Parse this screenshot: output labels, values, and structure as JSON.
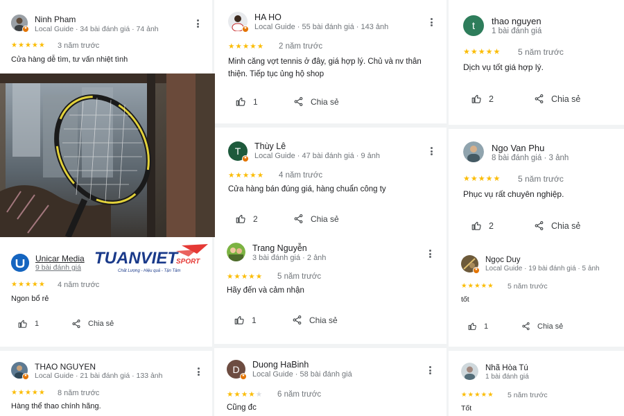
{
  "colors": {
    "star": "#fbbc04",
    "accent_red": "#e53935",
    "logo_blue": "#1a3a8a",
    "guide_badge": "#e37400"
  },
  "action_labels": {
    "share": "Chia sẻ"
  },
  "brand": {
    "name": "TUANVIET",
    "sport": "SPORT",
    "tagline": "Chất Lượng - Hiệu quả - Tận Tâm"
  },
  "reviews": [
    {
      "name": "Ninh Pham",
      "meta": "Local Guide · 34 bài đánh giá · 74 ảnh",
      "stars": 5,
      "ago": "3 năm trước",
      "text": "Cửa hàng dễ tìm, tư vấn nhiệt tình",
      "avatar": "photo-avatar"
    },
    {
      "name": "Unicar Media",
      "meta": "9 bài đánh giá",
      "stars": 5,
      "ago": "4 năm trước",
      "text": "Ngon bổ rẻ",
      "likes": "1",
      "avatar": "logo-avatar"
    },
    {
      "name": "THAO NGUYEN",
      "meta": "Local Guide · 21 bài đánh giá · 133 ảnh",
      "stars": 5,
      "ago": "8 năm trước",
      "text": "Hàng thể thao chính hãng.",
      "avatar": "photo-avatar"
    },
    {
      "name": "HA HO",
      "meta": "Local Guide · 55 bài đánh giá · 143 ảnh",
      "stars": 5,
      "ago": "2 năm trước",
      "text": "Minh căng vợt tennis ở đây, giá hợp lý. Chủ và nv thân thiện. Tiếp tục ủng hộ shop",
      "likes": "1",
      "avatar": "photo-avatar"
    },
    {
      "name": "Thùy Lê",
      "meta": "Local Guide · 47 bài đánh giá · 9 ảnh",
      "stars": 5,
      "ago": "4 năm trước",
      "text": "Cửa hàng bán đúng giá, hàng chuẩn công ty",
      "likes": "2",
      "avatar_letter": "T",
      "avatar_color": "#1e5a3c"
    },
    {
      "name": "Trang Nguyễn",
      "meta": "3 bài đánh giá · 2 ảnh",
      "stars": 5,
      "ago": "5 năm trước",
      "text": "Hãy đến và cảm nhận",
      "likes": "1",
      "avatar": "photo-avatar"
    },
    {
      "name": "Duong HaBinh",
      "meta": "Local Guide · 58 bài đánh giá",
      "stars": 4,
      "ago": "6 năm trước",
      "text": "Cũng đc",
      "avatar_letter": "D",
      "avatar_color": "#6d4c41"
    },
    {
      "name": "thao nguyen",
      "meta": "1 bài đánh giá",
      "stars": 5,
      "ago": "5 năm trước",
      "text": "Dịch vụ tốt giá hợp lý.",
      "likes": "2",
      "avatar_letter": "t",
      "avatar_color": "#2e7d5b"
    },
    {
      "name": "Ngo Van Phu",
      "meta": "8 bài đánh giá · 3 ảnh",
      "stars": 5,
      "ago": "5 năm trước",
      "text": "Phục vụ rất chuyên nghiệp.",
      "likes": "2",
      "avatar": "photo-avatar"
    },
    {
      "name": "Ngọc Duy",
      "meta": "Local Guide · 19 bài đánh giá · 5 ảnh",
      "stars": 5,
      "ago": "5 năm trước",
      "text": "tốt",
      "likes": "1",
      "avatar": "photo-avatar"
    },
    {
      "name": "Nhã Hòa Tú",
      "meta": "1 bài đánh giá",
      "stars": 5,
      "ago": "5 năm trước",
      "text": "Tốt",
      "avatar": "photo-avatar"
    }
  ]
}
